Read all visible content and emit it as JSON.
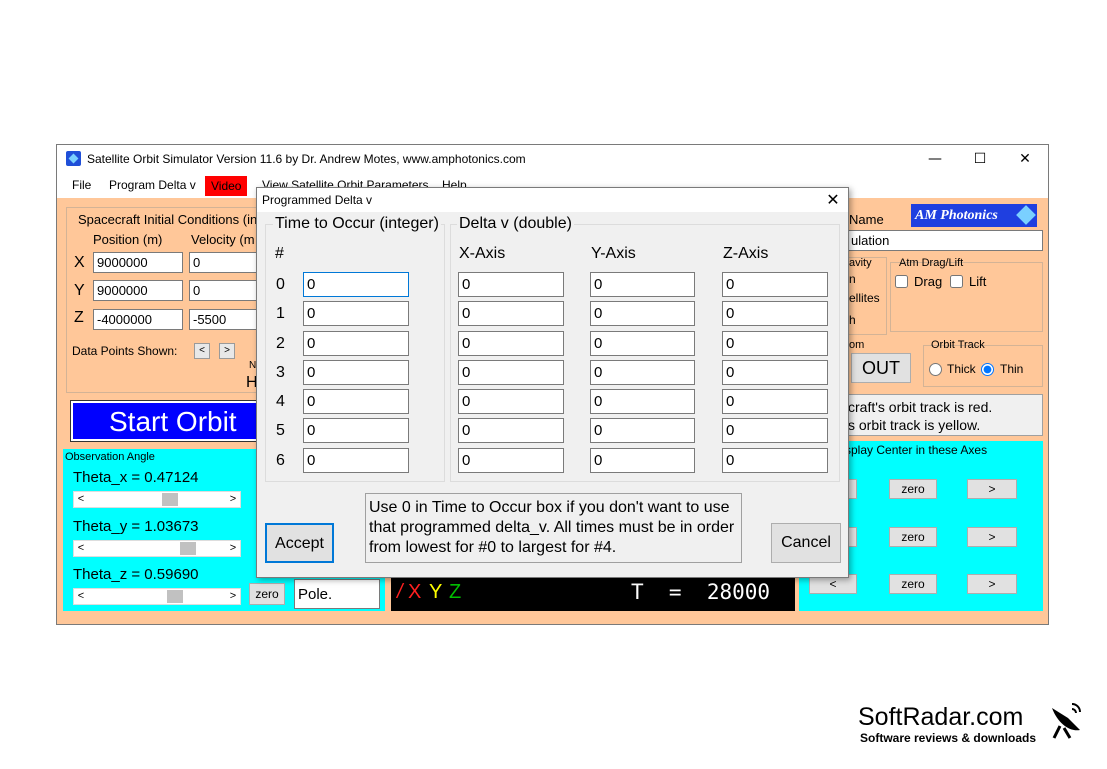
{
  "window": {
    "title": "Satellite Orbit Simulator Version 11.6 by Dr. Andrew Motes, www.amphotonics.com",
    "controls": {
      "minimize": "—",
      "maximize": "☐",
      "close": "✕"
    }
  },
  "menu": {
    "items": [
      "File",
      "Program Delta v",
      "Video",
      "View Satellite Orbit Parameters",
      "Help"
    ]
  },
  "brand": {
    "label": "AM Photonics"
  },
  "initial_conditions": {
    "title": "Spacecraft Initial Conditions (in",
    "position_header": "Position (m)",
    "velocity_header": "Velocity (m",
    "rows": [
      {
        "axis": "X",
        "position": "9000000",
        "velocity": "0"
      },
      {
        "axis": "Y",
        "position": "9000000",
        "velocity": "0"
      },
      {
        "axis": "Z",
        "position": "-4000000",
        "velocity": "-5500"
      }
    ],
    "data_points_label": "Data Points Shown:",
    "prev": "<",
    "next": ">",
    "hidden_frag1": "N",
    "hidden_frag2": "H"
  },
  "start_orbit": {
    "label": "Start Orbit"
  },
  "observation": {
    "title": "Observation Angle",
    "theta_x": "Theta_x = 0.47124",
    "theta_y": "Theta_y = 1.03673",
    "theta_z": "Theta_z = 0.59690",
    "zero": "zero",
    "pole": "Pole.",
    "scroll_left": "<",
    "scroll_right": ">",
    "levels": {
      "theta_x": 0.6,
      "theta_y": 0.74,
      "theta_z": 0.64
    }
  },
  "view": {
    "axes": [
      "/",
      "X",
      "Y",
      "Z"
    ],
    "time": "T  =  28000"
  },
  "right_panel": {
    "name_label": "Name",
    "name_value": "ulation",
    "gravity_frag": "avity",
    "gravity_frag2": "n",
    "gravity_frag3": "ellites",
    "gravity_frag4": "h",
    "atm_title": "Atm Drag/Lift",
    "drag": "Drag",
    "lift": "Lift",
    "zoom_frag": "om",
    "zoom_out": "OUT",
    "orbit_track_title": "Orbit Track",
    "thick": "Thick",
    "thin": "Thin",
    "info_line1": "craft's orbit track is red.",
    "info_line2": "s orbit track is yellow.",
    "display_center": "splay Center in these Axes",
    "zero": "zero",
    "lt": "<",
    "gt": ">"
  },
  "dialog": {
    "title": "Programmed Delta v",
    "close": "✕",
    "time_group": "Time to Occur (integer)",
    "delta_group": "Delta v (double)",
    "hash": "#",
    "x_axis": "X-Axis",
    "y_axis": "Y-Axis",
    "z_axis": "Z-Axis",
    "rows": [
      {
        "index": "0",
        "time": "0",
        "x": "0",
        "y": "0",
        "z": "0"
      },
      {
        "index": "1",
        "time": "0",
        "x": "0",
        "y": "0",
        "z": "0"
      },
      {
        "index": "2",
        "time": "0",
        "x": "0",
        "y": "0",
        "z": "0"
      },
      {
        "index": "3",
        "time": "0",
        "x": "0",
        "y": "0",
        "z": "0"
      },
      {
        "index": "4",
        "time": "0",
        "x": "0",
        "y": "0",
        "z": "0"
      },
      {
        "index": "5",
        "time": "0",
        "x": "0",
        "y": "0",
        "z": "0"
      },
      {
        "index": "6",
        "time": "0",
        "x": "0",
        "y": "0",
        "z": "0"
      }
    ],
    "note": "Use 0 in Time to Occur box if you don't want to use that programmed delta_v.  All times must be in order from lowest for #0 to largest for #4.",
    "accept": "Accept",
    "cancel": "Cancel"
  },
  "watermark": {
    "title": "SoftRadar.com",
    "subtitle": "Software reviews & downloads"
  },
  "colors": {
    "window_bg": "#ffc799",
    "start_button": "#0000ff",
    "panel_cyan": "#00ffff",
    "video_menu": "#ff0000",
    "brand": "#1f3fe0",
    "axis_x": "#ff2020",
    "axis_y": "#ffff00",
    "axis_z": "#00c000"
  }
}
